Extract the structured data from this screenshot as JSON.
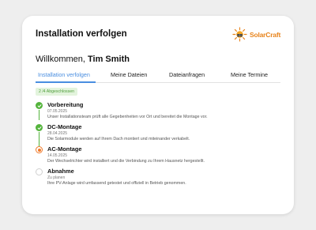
{
  "header": {
    "title": "Installation verfolgen",
    "logo_text": "SolarCraft"
  },
  "welcome": {
    "greeting": "Willkommen,",
    "name": "Tim Smith"
  },
  "tabs": [
    {
      "label": "Installation verfolgen",
      "active": true
    },
    {
      "label": "Meine Dateien",
      "active": false
    },
    {
      "label": "Dateianfragen",
      "active": false
    },
    {
      "label": "Meine Termine",
      "active": false
    }
  ],
  "progress": {
    "label": "2 /4 Abgeschlossen",
    "completed": 2,
    "total": 4
  },
  "steps": [
    {
      "title": "Vorbereitung",
      "date": "07.05.2025",
      "description": "Unser Installationsteam prüft alle Gegebenheiten vor Ort und bereitet die Montage vor.",
      "status": "done"
    },
    {
      "title": "DC-Montage",
      "date": "28.04.2025",
      "description": "Die Solarmodule werden auf Ihrem Dach montiert und miteinander verkabelt.",
      "status": "done"
    },
    {
      "title": "AC-Montage",
      "date": "14.05.2025",
      "description": "Der Wechselrichter wird installiert und die Verbindung zu Ihrem Hausnetz hergestellt.",
      "status": "current"
    },
    {
      "title": "Abnahme",
      "date": "Zu planen",
      "description": "Ihre PV-Anlage wird umfassend getestet und offiziell in Betrieb genommen.",
      "status": "pending"
    }
  ],
  "colors": {
    "accent": "#4a8ee0",
    "done": "#54b43c",
    "current": "#f07a2a",
    "brand": "#e8841c"
  }
}
